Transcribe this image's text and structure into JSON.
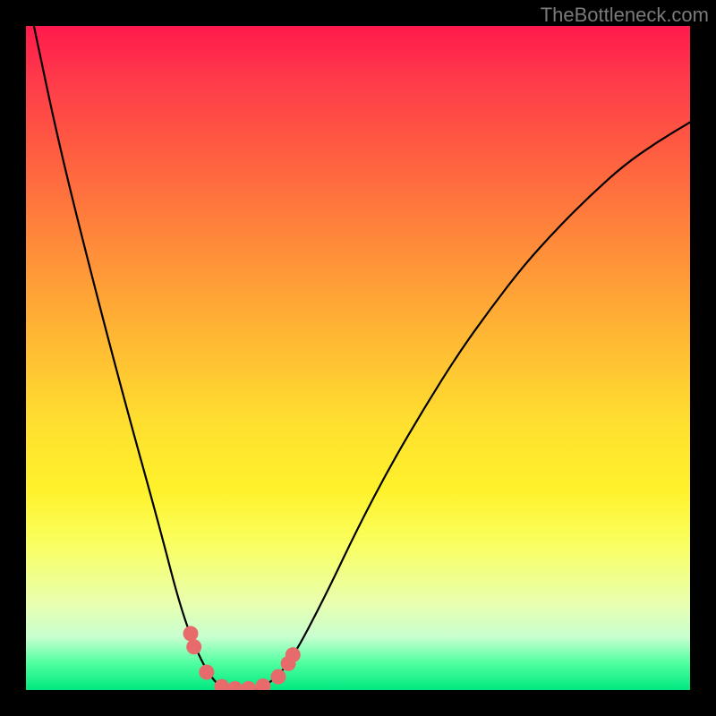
{
  "attribution": "TheBottleneck.com",
  "chart_data": {
    "type": "line",
    "title": "",
    "xlabel": "",
    "ylabel": "",
    "xlim": [
      0,
      1
    ],
    "ylim": [
      0,
      1
    ],
    "series": [
      {
        "name": "bottleneck-curve",
        "x": [
          0.012,
          0.05,
          0.1,
          0.15,
          0.2,
          0.235,
          0.265,
          0.29,
          0.31,
          0.325,
          0.345,
          0.37,
          0.4,
          0.45,
          0.5,
          0.55,
          0.6,
          0.65,
          0.7,
          0.75,
          0.8,
          0.85,
          0.9,
          0.95,
          1.0
        ],
        "values": [
          1.0,
          0.82,
          0.62,
          0.43,
          0.25,
          0.115,
          0.04,
          0.005,
          0.0,
          0.0,
          0.0,
          0.012,
          0.045,
          0.14,
          0.245,
          0.34,
          0.425,
          0.505,
          0.575,
          0.64,
          0.695,
          0.745,
          0.79,
          0.825,
          0.855
        ]
      }
    ],
    "markers": {
      "name": "curve-markers",
      "color": "#e86b6b",
      "points": [
        {
          "x": 0.248,
          "y": 0.085
        },
        {
          "x": 0.253,
          "y": 0.065
        },
        {
          "x": 0.272,
          "y": 0.027
        },
        {
          "x": 0.295,
          "y": 0.005
        },
        {
          "x": 0.315,
          "y": 0.002
        },
        {
          "x": 0.335,
          "y": 0.002
        },
        {
          "x": 0.357,
          "y": 0.006
        },
        {
          "x": 0.38,
          "y": 0.02
        },
        {
          "x": 0.395,
          "y": 0.04
        },
        {
          "x": 0.402,
          "y": 0.053
        }
      ]
    }
  }
}
